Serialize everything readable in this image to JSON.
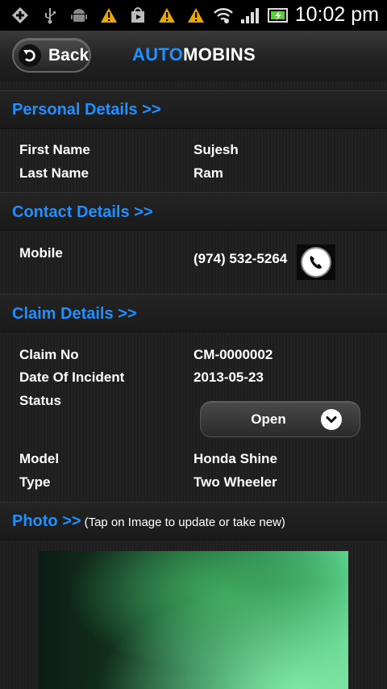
{
  "status_bar": {
    "time": "10:02 pm",
    "icons": [
      "add-icon",
      "usb-icon",
      "android-icon",
      "warning-icon",
      "play-store-icon",
      "warning-icon",
      "warning-icon",
      "wifi-icon",
      "signal-icon",
      "battery-charging-icon"
    ]
  },
  "header": {
    "back_label": "Back",
    "title_part1": "AUTO",
    "title_part2": "MOBINS",
    "accent_color": "#1e90ff"
  },
  "personal": {
    "title": "Personal Details >>",
    "first_name_label": "First Name",
    "first_name": "Sujesh",
    "last_name_label": "Last Name",
    "last_name": "Ram"
  },
  "contact": {
    "title": "Contact Details >>",
    "mobile_label": "Mobile",
    "mobile": "(974) 532-5264"
  },
  "claim": {
    "title": "Claim Details >>",
    "claim_no_label": "Claim No",
    "claim_no": "CM-0000002",
    "date_label": "Date Of Incident",
    "date": "2013-05-23",
    "status_label": "Status",
    "status_value": "Open",
    "model_label": "Model",
    "model": "Honda Shine",
    "type_label": "Type",
    "type": "Two Wheeler"
  },
  "photo": {
    "title": "Photo >>",
    "hint": "(Tap on Image to update or take new)"
  }
}
